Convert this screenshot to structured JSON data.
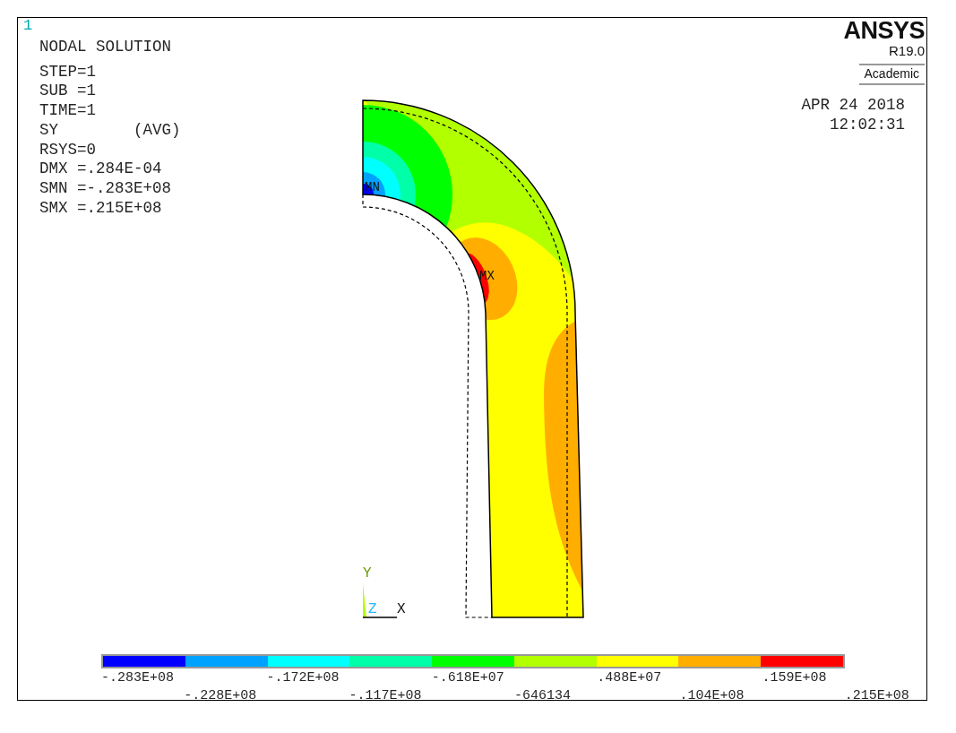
{
  "plot_number": "1",
  "title": "NODAL SOLUTION",
  "info_lines": [
    "STEP=1",
    "SUB =1",
    "TIME=1",
    "SY        (AVG)",
    "RSYS=0",
    "DMX =.284E-04",
    "SMN =-.283E+08",
    "SMX =.215E+08"
  ],
  "logo": {
    "name": "ANSYS",
    "release": "R19.0",
    "edition": "Academic"
  },
  "date": "APR 24 2018",
  "time": "12:02:31",
  "markers": [
    {
      "kind": "min",
      "label": "MN"
    },
    {
      "kind": "max",
      "label": "MX"
    }
  ],
  "axes": {
    "y": "Y",
    "z": "Z",
    "x": "X"
  },
  "legend": {
    "bands": [
      {
        "label": "-.283E+08",
        "color": "#0000ff"
      },
      {
        "label": "-.228E+08",
        "color": "#00a2ff"
      },
      {
        "label": "-.172E+08",
        "color": "#00ffff"
      },
      {
        "label": "-.117E+08",
        "color": "#00ffa8"
      },
      {
        "label": "-.618E+07",
        "color": "#00ff00"
      },
      {
        "label": "-646134",
        "color": "#b2ff00"
      },
      {
        "label": ".488E+07",
        "color": "#ffff00"
      },
      {
        "label": ".104E+08",
        "color": "#ffae00"
      },
      {
        "label": ".159E+08",
        "color": "#ff0000"
      }
    ],
    "end_label": ".215E+08"
  }
}
